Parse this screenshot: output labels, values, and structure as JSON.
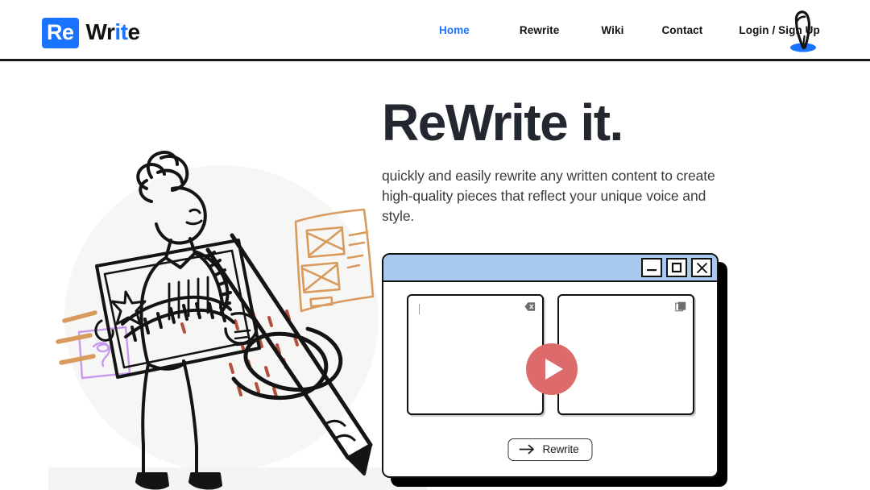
{
  "header": {
    "logo": {
      "part1": "Re",
      "part2": "Wr",
      "part3": "it",
      "part4": "e"
    },
    "nav": [
      {
        "label": "Home",
        "active": true
      },
      {
        "label": "Rewrite",
        "active": false
      },
      {
        "label": "Wiki",
        "active": false
      },
      {
        "label": "Contact",
        "active": false
      },
      {
        "label": "Login / Sign Up",
        "active": false
      }
    ],
    "pen_icon": "pen-icon"
  },
  "hero": {
    "title": "ReWrite it.",
    "subtitle": "quickly and easily rewrite any written content to create high-quality pieces that reflect your unique voice and style."
  },
  "illustration": {
    "name": "person-writing-illustration",
    "alt": "hand drawn person holding a document with a large pencil"
  },
  "app_window": {
    "titlebar": {
      "minimize_label": "minimize",
      "maximize_label": "maximize",
      "close_label": "close"
    },
    "input_pane": {
      "name": "input-textarea",
      "value": "",
      "placeholder": "",
      "clear_icon": "clear-icon"
    },
    "output_pane": {
      "name": "output-textarea",
      "value": "",
      "copy_icon": "copy-icon"
    },
    "rewrite_button": {
      "label": "Rewrite",
      "icon": "arrow-right-icon"
    }
  },
  "play_button": {
    "name": "play-button",
    "label": "Play"
  },
  "colors": {
    "brand_blue": "#1a73ff",
    "titlebar_blue": "#a8c8ee",
    "play_red": "#dd6b6b",
    "text_dark": "#232830",
    "illus_orange": "#d99a5e",
    "illus_purple": "#c79aee",
    "illus_red": "#b2503f"
  }
}
